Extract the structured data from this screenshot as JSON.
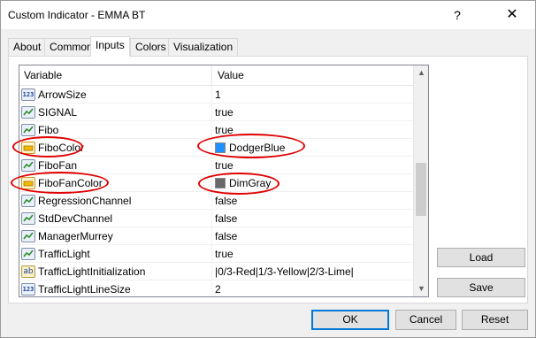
{
  "window": {
    "title": "Custom Indicator - EMMA BT",
    "help_glyph": "?",
    "close_glyph": "✕"
  },
  "tabs": [
    {
      "label": "About"
    },
    {
      "label": "Common"
    },
    {
      "label": "Inputs",
      "active": true
    },
    {
      "label": "Colors"
    },
    {
      "label": "Visualization"
    }
  ],
  "grid": {
    "header_variable": "Variable",
    "header_value": "Value",
    "rows": [
      {
        "icon": "numeric-icon",
        "icon_text": "123",
        "variable": "ArrowSize",
        "value": "1"
      },
      {
        "icon": "boolean-icon",
        "variable": "SIGNAL",
        "value": "true"
      },
      {
        "icon": "boolean-icon",
        "variable": "Fibo",
        "value": "true"
      },
      {
        "icon": "color-icon",
        "variable": "FiboColor",
        "value": "DodgerBlue",
        "swatch": "#1e90ff"
      },
      {
        "icon": "boolean-icon",
        "variable": "FiboFan",
        "value": "true"
      },
      {
        "icon": "color-icon",
        "variable": "FiboFanColor",
        "value": "DimGray",
        "swatch": "#696969"
      },
      {
        "icon": "boolean-icon",
        "variable": "RegressionChannel",
        "value": "false"
      },
      {
        "icon": "boolean-icon",
        "variable": "StdDevChannel",
        "value": "false"
      },
      {
        "icon": "boolean-icon",
        "variable": "ManagerMurrey",
        "value": "false"
      },
      {
        "icon": "boolean-icon",
        "variable": "TrafficLight",
        "value": "true"
      },
      {
        "icon": "string-icon",
        "icon_text": "ab",
        "variable": "TrafficLightInitialization",
        "value": "|0/3-Red|1/3-Yellow|2/3-Lime|"
      },
      {
        "icon": "numeric-icon",
        "icon_text": "123",
        "variable": "TrafficLightLineSize",
        "value": "2"
      }
    ]
  },
  "side_buttons": {
    "load": "Load",
    "save": "Save"
  },
  "bottom_buttons": {
    "ok": "OK",
    "cancel": "Cancel",
    "reset": "Reset"
  },
  "colors": {
    "annotation": "#e00000",
    "default_button_border": "#0078d7"
  }
}
